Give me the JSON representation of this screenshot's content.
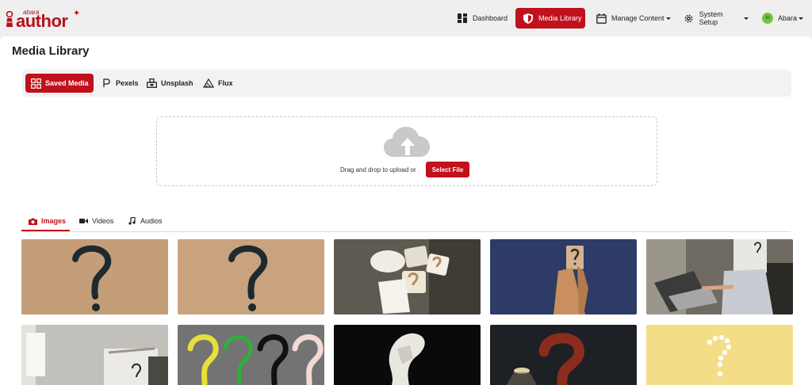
{
  "app": {
    "logo_small": "abara",
    "logo_main": "author"
  },
  "nav": {
    "dashboard": "Dashboard",
    "media_library": "Media Library",
    "manage_content": "Manage Content",
    "system_setup": "System Setup",
    "user_initials": "AI",
    "user_name": "Abara"
  },
  "page": {
    "title": "Media Library"
  },
  "sources": {
    "saved_media": "Saved Media",
    "pexels": "Pexels",
    "unsplash": "Unsplash",
    "flux": "Flux"
  },
  "upload": {
    "prompt": "Drag and drop to upload or",
    "button": "Select File"
  },
  "media_tabs": {
    "images": "Images",
    "videos": "Videos",
    "audios": "Audios"
  },
  "colors": {
    "accent": "#c0111c",
    "background": "#efefef"
  },
  "images": [
    {
      "name": "question-mark-graffiti-wall-1"
    },
    {
      "name": "question-mark-graffiti-wall-2"
    },
    {
      "name": "paper-cards-question-marks"
    },
    {
      "name": "wooden-mannequin-question-card"
    },
    {
      "name": "person-laptop-question-head"
    },
    {
      "name": "person-box-head-question"
    },
    {
      "name": "colored-question-marks"
    },
    {
      "name": "crumpled-paper-black"
    },
    {
      "name": "red-question-mark-lamp"
    },
    {
      "name": "pill-question-mark-yellow"
    }
  ]
}
